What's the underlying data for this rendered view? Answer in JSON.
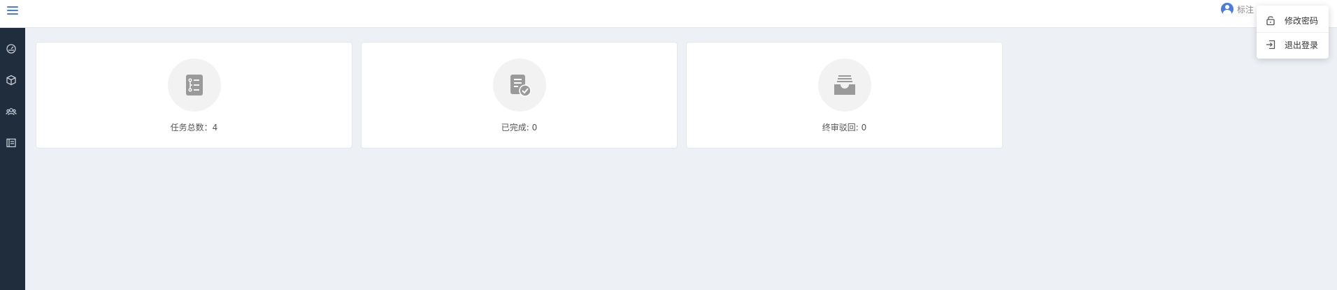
{
  "header": {
    "menu_icon": "hamburger-icon",
    "user": {
      "avatar_icon": "user-avatar-icon",
      "name": "标注"
    }
  },
  "sidebar": {
    "items": [
      {
        "icon": "dashboard-icon"
      },
      {
        "icon": "cube-icon"
      },
      {
        "icon": "people-icon"
      },
      {
        "icon": "book-icon"
      }
    ]
  },
  "dropdown": {
    "items": [
      {
        "icon": "lock-icon",
        "label": "修改密码"
      },
      {
        "icon": "logout-icon",
        "label": "退出登录"
      }
    ]
  },
  "cards": [
    {
      "icon": "task-list-icon",
      "label": "任务总数：4"
    },
    {
      "icon": "completed-doc-icon",
      "label": "已完成: 0"
    },
    {
      "icon": "inbox-icon",
      "label": "终审驳回: 0"
    }
  ],
  "colors": {
    "sidebar_bg": "#1f2d3d",
    "accent": "#4a7be0",
    "page_bg": "#edf1f5",
    "icon_gray": "#9a9a9a"
  }
}
